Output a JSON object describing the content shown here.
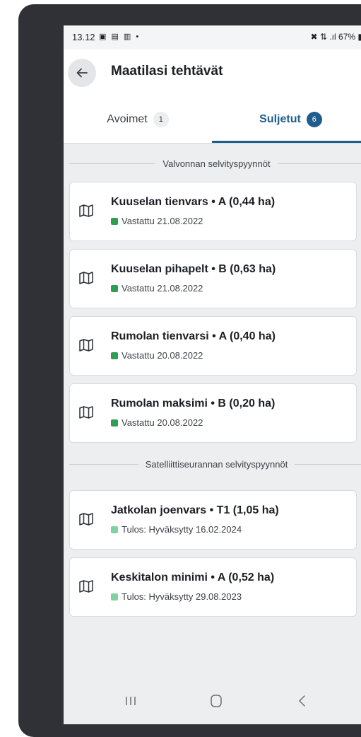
{
  "statusbar": {
    "time": "13.12",
    "left_icons": "▣ ▤ ▥ •",
    "battery": "67%",
    "signal_icons": "✖ ⇅ .ıl"
  },
  "header": {
    "title": "Maatilasi tehtävät"
  },
  "tabs": [
    {
      "label": "Avoimet",
      "count": "1",
      "active": false
    },
    {
      "label": "Suljetut",
      "count": "6",
      "active": true
    }
  ],
  "sections": [
    {
      "title": "Valvonnan selvityspyynnöt",
      "items": [
        {
          "title": "Kuuselan tienvars • A (0,44 ha)",
          "status": "Vastattu 21.08.2022",
          "status_color": "#2e9e55"
        },
        {
          "title": "Kuuselan pihapelt • B (0,63 ha)",
          "status": "Vastattu 21.08.2022",
          "status_color": "#2e9e55"
        },
        {
          "title": "Rumolan tienvarsi • A (0,40 ha)",
          "status": "Vastattu 20.08.2022",
          "status_color": "#2e9e55"
        },
        {
          "title": "Rumolan maksimi • B (0,20 ha)",
          "status": "Vastattu 20.08.2022",
          "status_color": "#2e9e55"
        }
      ]
    },
    {
      "title": "Satelliittiseurannan selvityspyynnöt",
      "items": [
        {
          "title": "Jatkolan joenvars • T1 (1,05 ha)",
          "status": "Tulos: Hyväksytty 16.02.2024",
          "status_color": "#7fd3a0"
        },
        {
          "title": "Keskitalon minimi • A (0,52 ha)",
          "status": "Tulos: Hyväksytty 29.08.2023",
          "status_color": "#7fd3a0"
        }
      ]
    }
  ],
  "colors": {
    "accent": "#1f5d8c",
    "answered": "#2e9e55",
    "approved": "#7fd3a0"
  },
  "icons": {
    "back": "arrow-left-icon",
    "item": "map-icon",
    "nav_recent": "recent-apps-icon",
    "nav_home": "home-icon",
    "nav_back": "chevron-left-icon"
  }
}
